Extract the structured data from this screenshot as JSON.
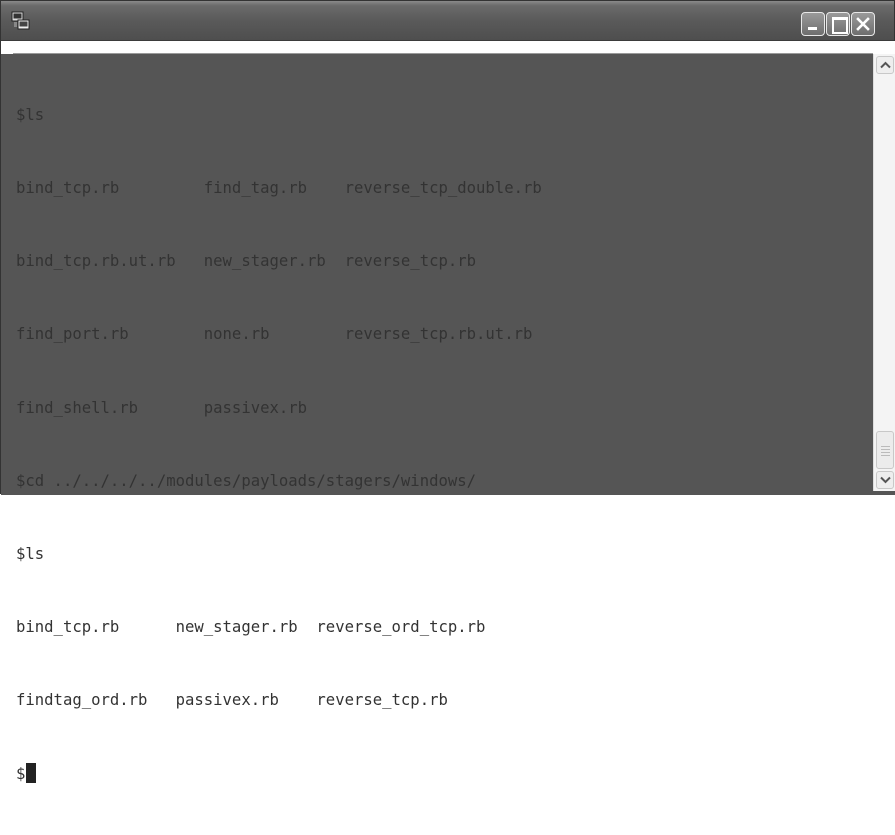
{
  "window": {
    "icon": "terminal-app-icon",
    "buttons": [
      "minimize-icon",
      "maximize-icon",
      "close-icon"
    ]
  },
  "terminal": {
    "lines": [
      "$ls",
      "bind_tcp.rb         find_tag.rb    reverse_tcp_double.rb",
      "bind_tcp.rb.ut.rb   new_stager.rb  reverse_tcp.rb",
      "find_port.rb        none.rb        reverse_tcp.rb.ut.rb",
      "find_shell.rb       passivex.rb",
      "$cd ../../../../modules/payloads/stagers/windows/",
      "$ls",
      "bind_tcp.rb      new_stager.rb  reverse_ord_tcp.rb",
      "findtag_ord.rb   passivex.rb    reverse_tcp.rb",
      "$"
    ]
  },
  "scrollbar": {
    "up_icon": "chevron-up-icon",
    "down_icon": "chevron-down-icon"
  }
}
